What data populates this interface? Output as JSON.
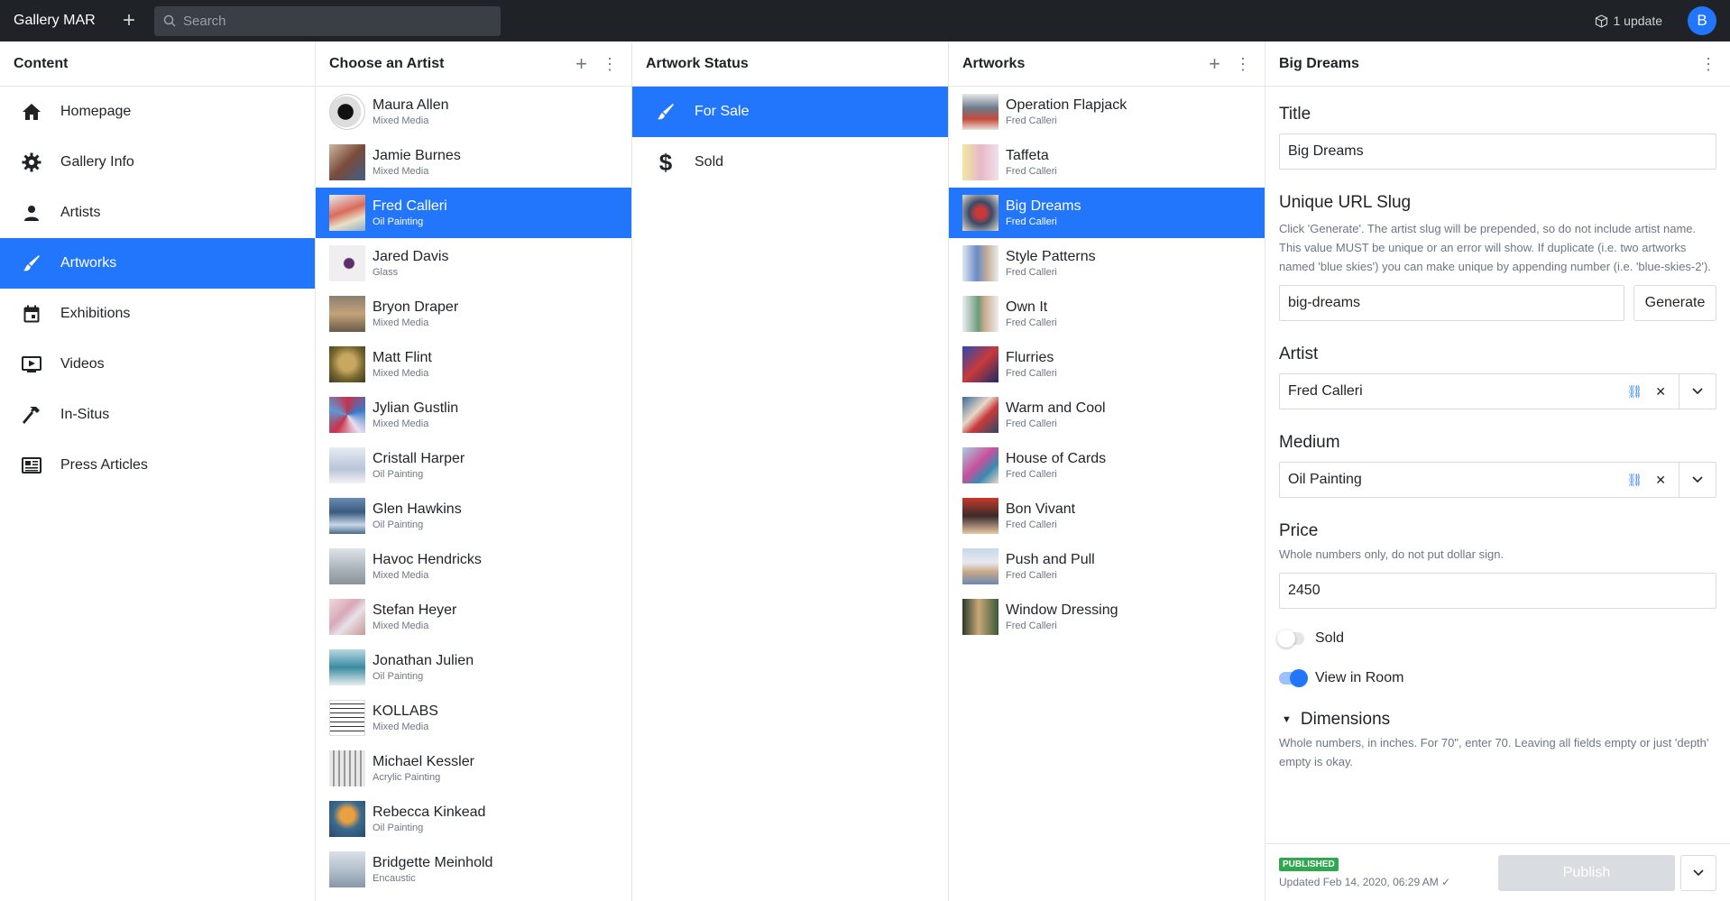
{
  "app": {
    "title": "Gallery MAR",
    "update_text": "1 update",
    "avatar_initial": "B"
  },
  "search": {
    "placeholder": "Search"
  },
  "content_pane": {
    "title": "Content",
    "items": [
      {
        "label": "Homepage",
        "icon": "home-icon"
      },
      {
        "label": "Gallery Info",
        "icon": "gear-icon"
      },
      {
        "label": "Artists",
        "icon": "person-icon"
      },
      {
        "label": "Artworks",
        "icon": "brush-icon"
      },
      {
        "label": "Exhibitions",
        "icon": "calendar-icon"
      },
      {
        "label": "Videos",
        "icon": "video-icon"
      },
      {
        "label": "In-Situs",
        "icon": "hammer-icon"
      },
      {
        "label": "Press Articles",
        "icon": "newspaper-icon"
      }
    ],
    "selected": "Artworks"
  },
  "artists_pane": {
    "title": "Choose an Artist",
    "items": [
      {
        "name": "Maura Allen",
        "medium": "Mixed Media"
      },
      {
        "name": "Jamie Burnes",
        "medium": "Mixed Media"
      },
      {
        "name": "Fred Calleri",
        "medium": "Oil Painting"
      },
      {
        "name": "Jared Davis",
        "medium": "Glass"
      },
      {
        "name": "Bryon Draper",
        "medium": "Mixed Media"
      },
      {
        "name": "Matt Flint",
        "medium": "Mixed Media"
      },
      {
        "name": "Jylian Gustlin",
        "medium": "Mixed Media"
      },
      {
        "name": "Cristall Harper",
        "medium": "Oil Painting"
      },
      {
        "name": "Glen Hawkins",
        "medium": "Oil Painting"
      },
      {
        "name": "Havoc Hendricks",
        "medium": "Mixed Media"
      },
      {
        "name": "Stefan Heyer",
        "medium": "Mixed Media"
      },
      {
        "name": "Jonathan Julien",
        "medium": "Oil Painting"
      },
      {
        "name": "KOLLABS",
        "medium": "Mixed Media"
      },
      {
        "name": "Michael Kessler",
        "medium": "Acrylic Painting"
      },
      {
        "name": "Rebecca Kinkead",
        "medium": "Oil Painting"
      },
      {
        "name": "Bridgette Meinhold",
        "medium": "Encaustic"
      }
    ],
    "selected": "Fred Calleri"
  },
  "status_pane": {
    "title": "Artwork Status",
    "items": [
      {
        "label": "For Sale",
        "icon": "brush-icon"
      },
      {
        "label": "Sold",
        "icon": "dollar-icon"
      }
    ],
    "selected": "For Sale"
  },
  "artworks_pane": {
    "title": "Artworks",
    "items": [
      {
        "title": "Operation Flapjack",
        "artist": "Fred Calleri"
      },
      {
        "title": "Taffeta",
        "artist": "Fred Calleri"
      },
      {
        "title": "Big Dreams",
        "artist": "Fred Calleri"
      },
      {
        "title": "Style Patterns",
        "artist": "Fred Calleri"
      },
      {
        "title": "Own It",
        "artist": "Fred Calleri"
      },
      {
        "title": "Flurries",
        "artist": "Fred Calleri"
      },
      {
        "title": "Warm and Cool",
        "artist": "Fred Calleri"
      },
      {
        "title": "House of Cards",
        "artist": "Fred Calleri"
      },
      {
        "title": "Bon Vivant",
        "artist": "Fred Calleri"
      },
      {
        "title": "Push and Pull",
        "artist": "Fred Calleri"
      },
      {
        "title": "Window Dressing",
        "artist": "Fred Calleri"
      }
    ],
    "selected": "Big Dreams"
  },
  "editor": {
    "title": "Big Dreams",
    "title_label": "Title",
    "title_value": "Big Dreams",
    "slug_label": "Unique URL Slug",
    "slug_help": "Click 'Generate'. The artist slug will be prepended, so do not include artist name. This value MUST be unique or an error will show. If duplicate (i.e. two artworks named 'blue skies') you can make unique by appending number (i.e. 'blue-skies-2').",
    "slug_value": "big-dreams",
    "generate_label": "Generate",
    "artist_label": "Artist",
    "artist_value": "Fred Calleri",
    "medium_label": "Medium",
    "medium_value": "Oil Painting",
    "price_label": "Price",
    "price_help": "Whole numbers only, do not put dollar sign.",
    "price_value": "2450",
    "sold_label": "Sold",
    "sold_on": false,
    "view_in_room_label": "View in Room",
    "view_in_room_on": true,
    "dimensions_label": "Dimensions",
    "dimensions_help": "Whole numbers, in inches. For 70\", enter 70. Leaving all fields empty or just 'depth' empty is okay.",
    "status_badge": "PUBLISHED",
    "updated_text": "Updated Feb 14, 2020, 06:29 AM ✓",
    "publish_label": "Publish"
  },
  "colors": {
    "accent": "#2276fc",
    "topbar": "#1f2226",
    "published": "#2fa84f"
  }
}
